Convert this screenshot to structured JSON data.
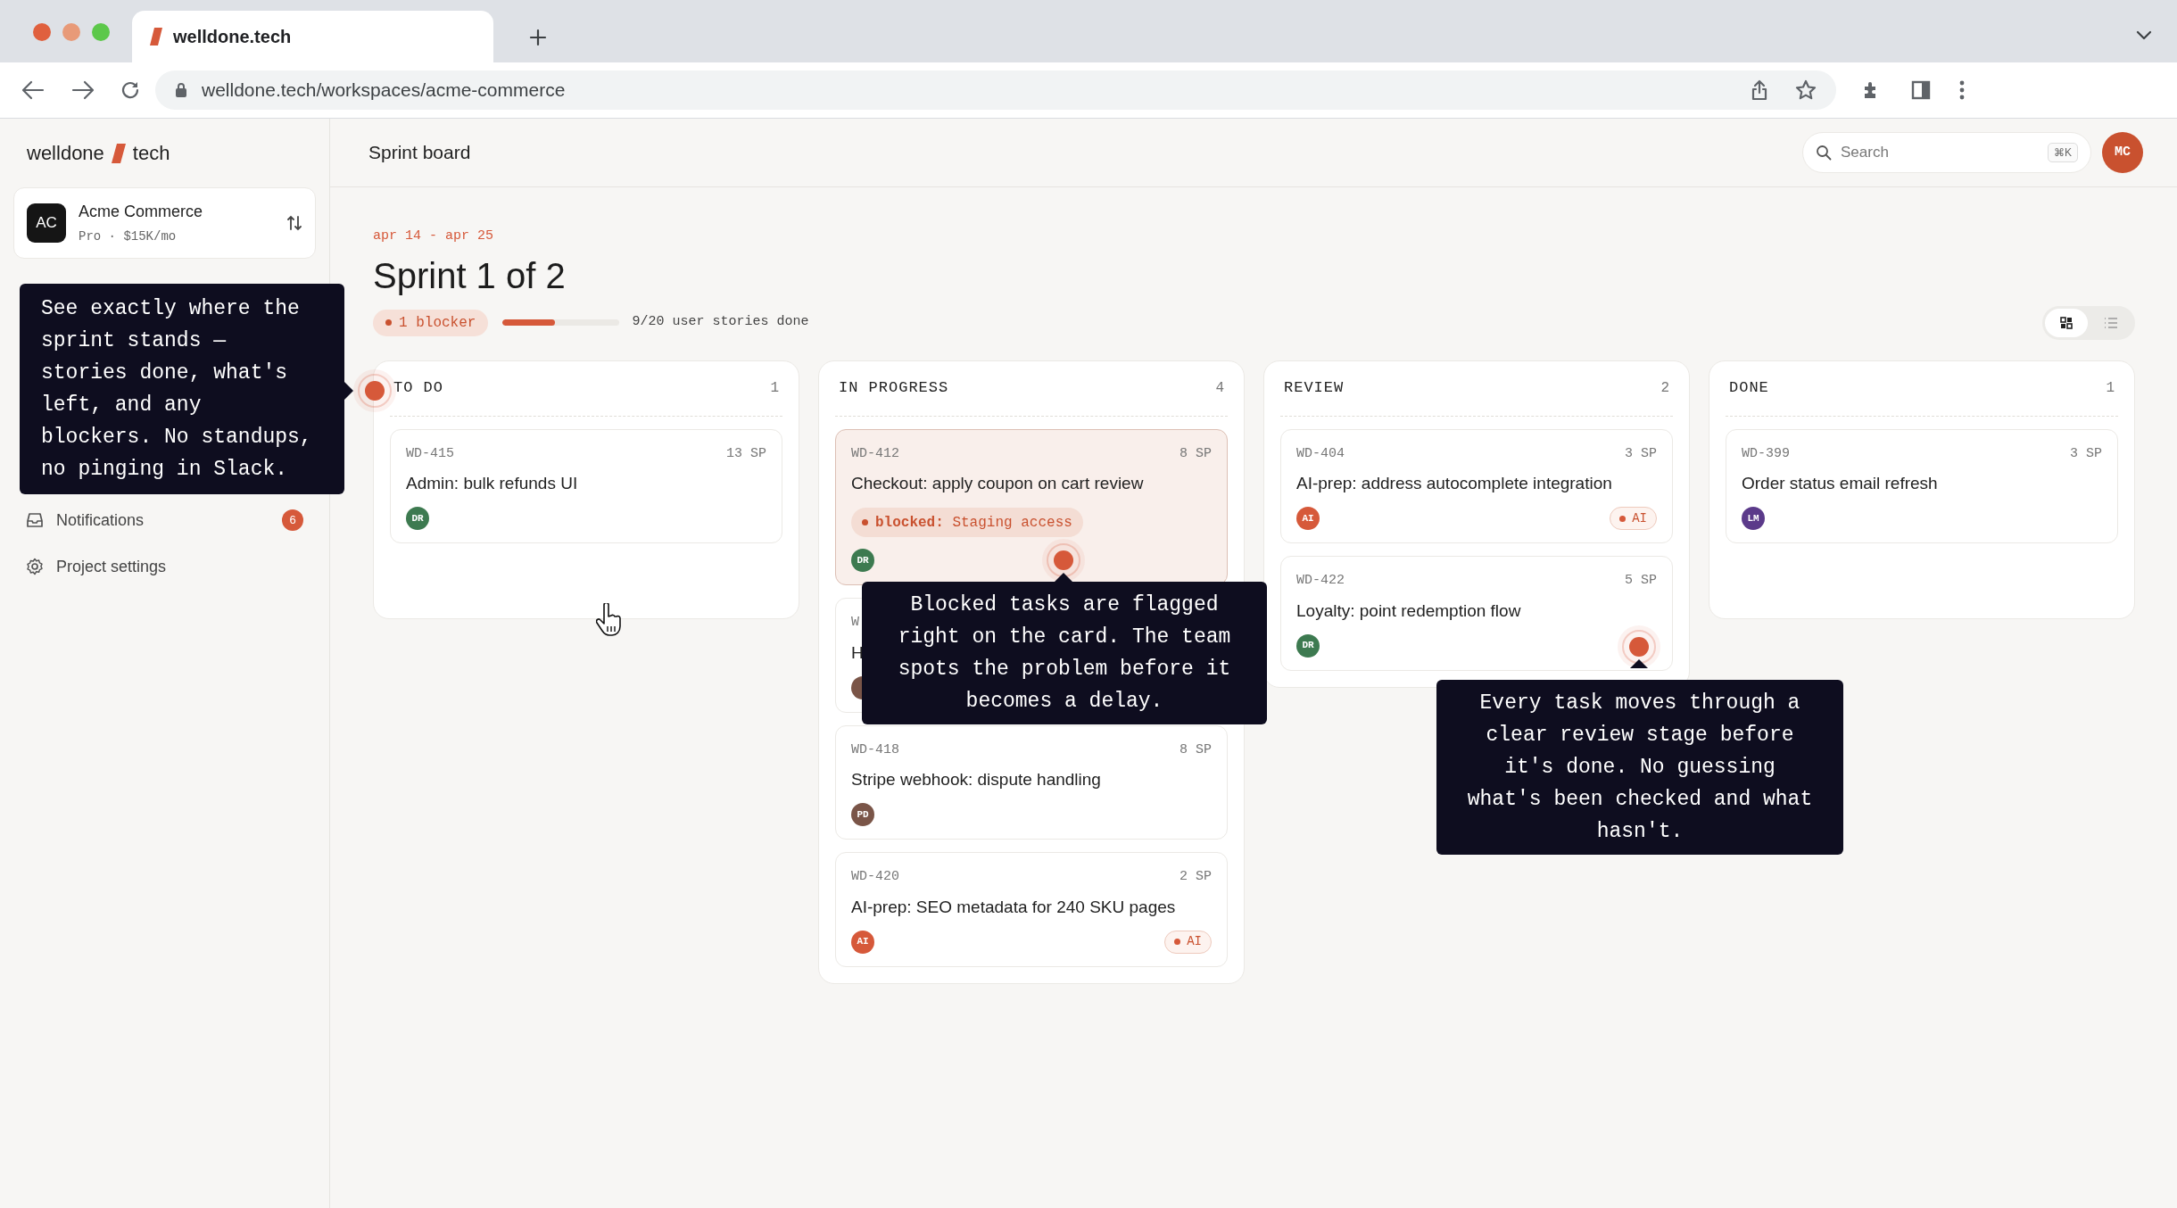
{
  "browser": {
    "tab_title": "welldone.tech",
    "url": "welldone.tech/workspaces/acme-commerce"
  },
  "sidebar": {
    "logo": {
      "left": "welldone",
      "right": "tech"
    },
    "workspace": {
      "initials": "AC",
      "name": "Acme Commerce",
      "plan": "Pro · $15K/mo"
    },
    "items": [
      {
        "label": "Notifications",
        "kind": "inbox",
        "badge": "6"
      },
      {
        "label": "Project settings",
        "kind": "settings"
      }
    ]
  },
  "header": {
    "title": "Sprint board",
    "search": {
      "placeholder": "Search",
      "shortcut": "⌘K"
    },
    "avatar": "MC"
  },
  "sprint": {
    "dates": "apr 14 - apr 25",
    "title": "Sprint 1 of 2",
    "blocker": "1 blocker",
    "progress": {
      "level": 0.45
    },
    "progress_text": "9/20 user stories done"
  },
  "view_toggle": [
    {
      "kind": "grid",
      "selected": true
    },
    {
      "kind": "list",
      "selected": false
    }
  ],
  "columns": [
    {
      "name": "TO DO",
      "count": "1",
      "cards": [
        {
          "id": "WD-415",
          "points": "13 SP",
          "title": "Admin: bulk refunds UI",
          "assignee": {
            "initials": "DR",
            "color": "#3d7a50"
          }
        }
      ]
    },
    {
      "name": "IN PROGRESS",
      "count": "4",
      "cards": [
        {
          "id": "WD-412",
          "points": "8 SP",
          "title": "Checkout: apply coupon on cart review",
          "blocked": "**blocked:** Staging access",
          "assignee": {
            "initials": "DR",
            "color": "#3d7a50"
          }
        },
        {
          "id": "W",
          "title": "H",
          "assignee": {
            "color": "#7a5548"
          }
        },
        {
          "id": "WD-418",
          "points": "8 SP",
          "title": "Stripe webhook: dispute handling",
          "assignee": {
            "initials": "PD",
            "color": "#7a5548"
          }
        },
        {
          "id": "WD-420",
          "points": "2 SP",
          "title": "AI-prep: SEO metadata for 240 SKU pages",
          "ai_tag": "AI",
          "assignee": {
            "initials": "AI",
            "color": "#d6593a"
          }
        }
      ]
    },
    {
      "name": "REVIEW",
      "count": "2",
      "cards": [
        {
          "id": "WD-404",
          "points": "3 SP",
          "title": "AI-prep: address autocomplete integration",
          "ai_tag": "AI",
          "assignee": {
            "initials": "AI",
            "color": "#d6593a"
          }
        },
        {
          "id": "WD-422",
          "points": "5 SP",
          "title": "Loyalty: point redemption flow",
          "assignee": {
            "initials": "DR",
            "color": "#3d7a50"
          }
        }
      ]
    },
    {
      "name": "DONE",
      "count": "1",
      "cards": [
        {
          "id": "WD-399",
          "points": "3 SP",
          "title": "Order status email refresh",
          "assignee": {
            "initials": "LM",
            "color": "#5b3a8a"
          }
        }
      ]
    }
  ],
  "callouts": [
    {
      "text": "See exactly where the sprint stands — stories done, what's left, and any blockers. No standups, no pinging in Slack."
    },
    {
      "text": "Blocked tasks are flagged right on the card. The team spots the problem before it becomes a delay."
    },
    {
      "text": "Every task moves through a clear review stage before it's done. No guessing what's been checked and what hasn't."
    }
  ]
}
